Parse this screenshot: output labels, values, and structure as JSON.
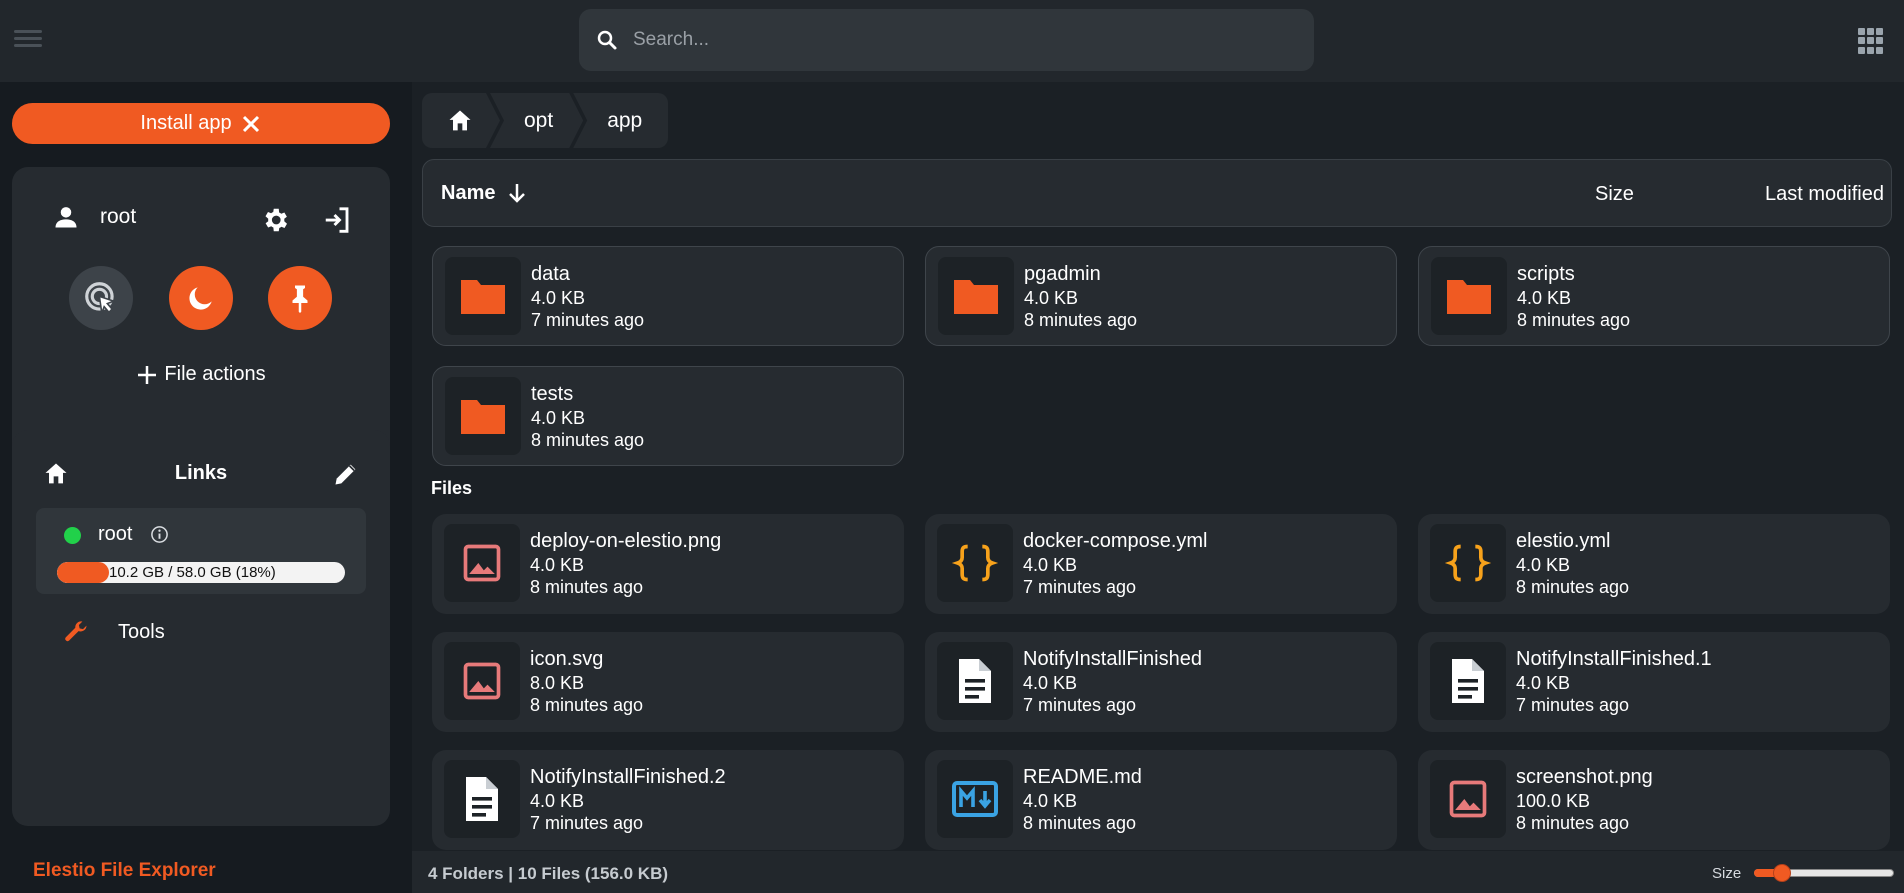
{
  "search": {
    "placeholder": "Search..."
  },
  "sidebar": {
    "install_label": "Install app",
    "user_name": "root",
    "file_actions_label": "File actions",
    "links_title": "Links",
    "link_name": "root",
    "usage_text": "10.2 GB / 58.0 GB (18%)",
    "usage_fraction": 0.18,
    "tools_label": "Tools",
    "brand": "Elestio File Explorer"
  },
  "breadcrumb": {
    "items": [
      "opt",
      "app"
    ]
  },
  "columns": {
    "name": "Name",
    "size": "Size",
    "modified": "Last modified"
  },
  "folders": [
    {
      "name": "data",
      "size": "4.0 KB",
      "date": "7 minutes ago"
    },
    {
      "name": "pgadmin",
      "size": "4.0 KB",
      "date": "8 minutes ago"
    },
    {
      "name": "scripts",
      "size": "4.0 KB",
      "date": "8 minutes ago"
    },
    {
      "name": "tests",
      "size": "4.0 KB",
      "date": "8 minutes ago"
    }
  ],
  "files_label": "Files",
  "files": [
    {
      "name": "deploy-on-elestio.png",
      "size": "4.0 KB",
      "date": "8 minutes ago",
      "icon": "image-icon"
    },
    {
      "name": "docker-compose.yml",
      "size": "4.0 KB",
      "date": "7 minutes ago",
      "icon": "braces-icon"
    },
    {
      "name": "elestio.yml",
      "size": "4.0 KB",
      "date": "8 minutes ago",
      "icon": "braces-icon"
    },
    {
      "name": "icon.svg",
      "size": "8.0 KB",
      "date": "8 minutes ago",
      "icon": "image-icon"
    },
    {
      "name": "NotifyInstallFinished",
      "size": "4.0 KB",
      "date": "7 minutes ago",
      "icon": "document-icon"
    },
    {
      "name": "NotifyInstallFinished.1",
      "size": "4.0 KB",
      "date": "7 minutes ago",
      "icon": "document-icon"
    },
    {
      "name": "NotifyInstallFinished.2",
      "size": "4.0 KB",
      "date": "7 minutes ago",
      "icon": "document-icon"
    },
    {
      "name": "README.md",
      "size": "4.0 KB",
      "date": "8 minutes ago",
      "icon": "markdown-icon"
    },
    {
      "name": "screenshot.png",
      "size": "100.0 KB",
      "date": "8 minutes ago",
      "icon": "image-icon"
    }
  ],
  "status": {
    "summary": "4 Folders | 10 Files (156.0 KB)",
    "size_label": "Size",
    "size_fraction": 0.2
  },
  "colors": {
    "accent": "#f05a22",
    "online": "#21d14a",
    "image_icon": "#e77a7a",
    "braces_icon": "#f7a21b",
    "markdown_icon": "#3aa3e3"
  }
}
